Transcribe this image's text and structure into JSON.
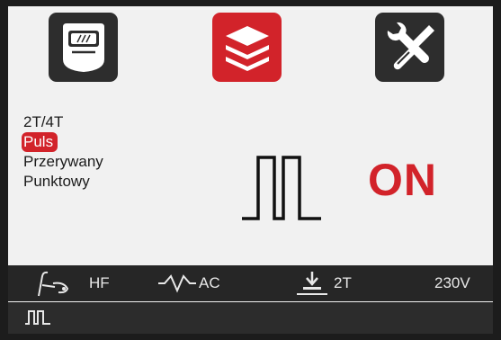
{
  "tiles": [
    {
      "name": "welding-helmet",
      "active": false
    },
    {
      "name": "layers",
      "active": true
    },
    {
      "name": "tools",
      "active": false
    }
  ],
  "menu": {
    "items": [
      "2T/4T",
      "Puls",
      "Przerywany",
      "Punktowy"
    ],
    "selected": "Puls"
  },
  "main": {
    "mode_icon": "pulse-wave-icon",
    "status": "ON"
  },
  "status_bar": {
    "torch_icon": "tig-torch-icon",
    "ignition": "HF",
    "wave_icon": "ac-wave-icon",
    "current_type": "AC",
    "trigger_icon": "trigger-icon",
    "trigger_mode": "2T",
    "voltage": "230V"
  },
  "bottom_bar": {
    "icon": "pulse-icon"
  },
  "colors": {
    "accent": "#d2232a",
    "tile": "#2d2d2d",
    "screen_bg": "#f1f1f1",
    "bar_bg": "#262626"
  }
}
